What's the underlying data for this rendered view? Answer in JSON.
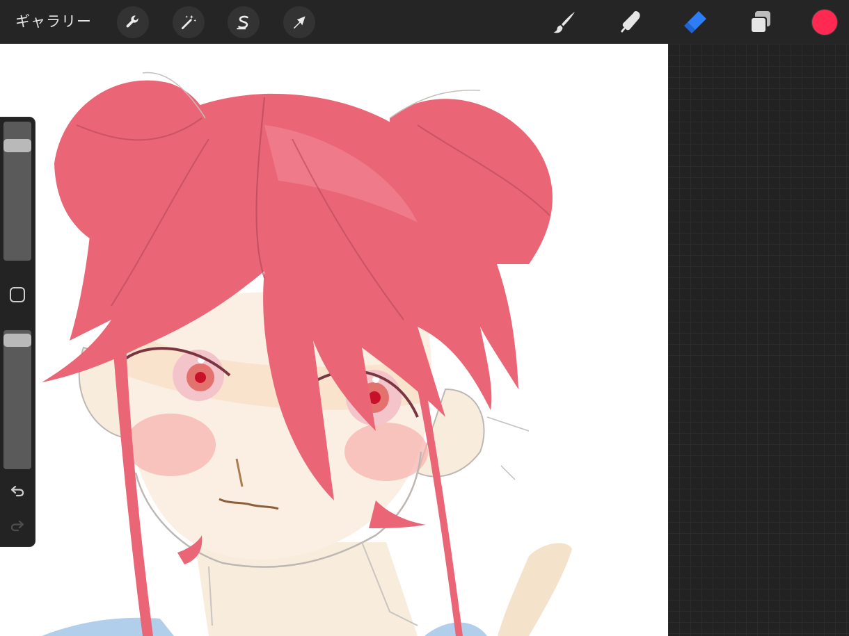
{
  "topbar": {
    "gallery_label": "ギャラリー",
    "left_actions": [
      {
        "name": "actions",
        "icon": "wrench-icon"
      },
      {
        "name": "adjustments",
        "icon": "magic-wand-icon"
      },
      {
        "name": "selection",
        "icon": "selection-s-icon"
      },
      {
        "name": "transform",
        "icon": "arrow-cursor-icon"
      }
    ],
    "right_tools": [
      {
        "name": "brush",
        "icon": "brush-icon",
        "active": false
      },
      {
        "name": "smudge",
        "icon": "smudge-finger-icon",
        "active": false
      },
      {
        "name": "eraser",
        "icon": "eraser-icon",
        "active": true
      },
      {
        "name": "layers",
        "icon": "layers-icon",
        "active": false
      }
    ],
    "current_color": "#ff2952",
    "accent_color": "#2d7df6"
  },
  "sidebar": {
    "brush_size_level": 0.86,
    "opacity_level": 0.97,
    "modify_button": "square-icon",
    "undo": "undo-arrow-icon",
    "redo": "redo-arrow-icon"
  },
  "canvas": {
    "subject": "drawing-of-red-haired-girl",
    "hair_color": "#ea6576",
    "skin_color": "#fbeee2",
    "blush_color": "#f6b1ad",
    "eye_color": "#d9434f",
    "sketch_line_color": "#bdb7b3"
  }
}
